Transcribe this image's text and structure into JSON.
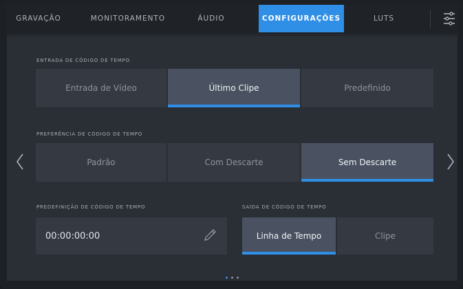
{
  "tabs": [
    {
      "label": "GRAVAÇÃO",
      "active": false
    },
    {
      "label": "MONITORAMENTO",
      "active": false
    },
    {
      "label": "ÁUDIO",
      "active": false
    },
    {
      "label": "CONFIGURAÇÕES",
      "active": true
    },
    {
      "label": "LUTS",
      "active": false
    }
  ],
  "timecode_input": {
    "label": "ENTRADA DE CÓDIGO DE TEMPO",
    "options": [
      "Entrada de Vídeo",
      "Último Clipe",
      "Predefinido"
    ],
    "selected": "Último Clipe"
  },
  "timecode_preference": {
    "label": "PREFERÊNCIA DE CÓDIGO DE TEMPO",
    "options": [
      "Padrão",
      "Com Descarte",
      "Sem Descarte"
    ],
    "selected": "Sem Descarte"
  },
  "timecode_preset": {
    "label": "PREDEFINIÇÃO DE CÓDIGO DE TEMPO",
    "value": "00:00:00:00"
  },
  "timecode_output": {
    "label": "SAÍDA DE CÓDIGO DE TEMPO",
    "options": [
      "Linha de Tempo",
      "Clipe"
    ],
    "selected": "Linha de Tempo"
  },
  "icons": {
    "settings": "sliders-icon",
    "edit": "pencil-icon",
    "prev": "chevron-left-icon",
    "next": "chevron-right-icon"
  },
  "page_indicator": {
    "count": 3,
    "current": 1
  },
  "colors": {
    "accent": "#2f8fe6",
    "panel": "#2a2e35",
    "button": "#343942",
    "selected": "#4a5261"
  }
}
